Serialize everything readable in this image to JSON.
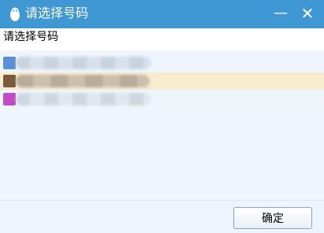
{
  "window": {
    "title": "请选择号码",
    "minimize_glyph": "—",
    "close_glyph": "✕"
  },
  "prompt": "请选择号码",
  "accounts": [
    {
      "avatar_color": "#5b8fd6",
      "selected": false
    },
    {
      "avatar_color": "#7a5a3a",
      "selected": true
    },
    {
      "avatar_color": "#c04cc7",
      "selected": false
    }
  ],
  "footer": {
    "confirm_label": "确定"
  },
  "colors": {
    "titlebar": "#3f97d4",
    "selected_row": "#f7ebd0",
    "list_bg": "#eef5fc"
  },
  "icons": {
    "app": "qq-penguin-icon",
    "minimize": "minimize-icon",
    "close": "close-icon"
  }
}
